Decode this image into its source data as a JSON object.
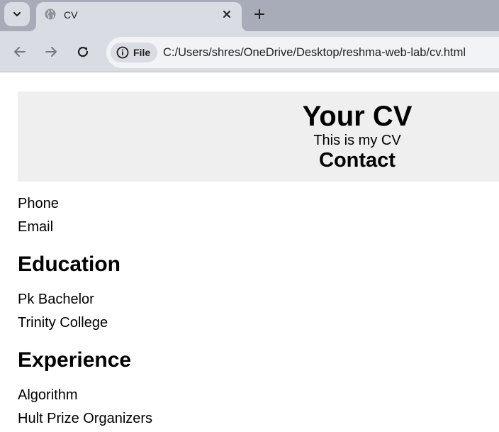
{
  "browser": {
    "tab": {
      "title": "CV"
    },
    "address": {
      "chip_label": "File",
      "url": "C:/Users/shres/OneDrive/Desktop/reshma-web-lab/cv.html"
    }
  },
  "cv": {
    "header": {
      "title": "Your CV",
      "subtitle": "This is my CV",
      "contact_heading": "Contact"
    },
    "contact_items": [
      "Phone",
      "Email"
    ],
    "education": {
      "heading": "Education",
      "items": [
        "Pk Bachelor",
        "Trinity College"
      ]
    },
    "experience": {
      "heading": "Experience",
      "items": [
        "Algorithm",
        "Hult Prize Organizers"
      ]
    }
  },
  "icons": {
    "tab_search": "chevron-down-icon",
    "favicon": "globe-icon",
    "close": "close-icon",
    "new_tab": "plus-icon",
    "back": "back-arrow-icon",
    "forward": "forward-arrow-icon",
    "reload": "reload-icon",
    "site_info": "info-icon"
  },
  "colors": {
    "tabstrip": "#a8abb8",
    "toolbar": "#dadce3",
    "omnibox": "#f1f3f6",
    "cv_header_bg": "#efefef"
  }
}
